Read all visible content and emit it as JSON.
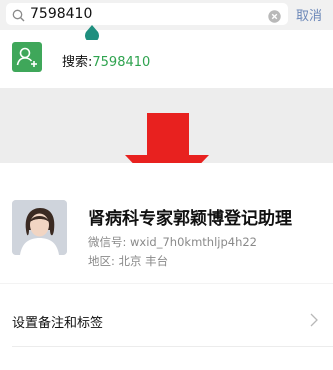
{
  "search": {
    "value": "7598410",
    "cancel_label": "取消"
  },
  "result": {
    "prefix": "搜索:",
    "keyword": "7598410"
  },
  "profile": {
    "name": "肾病科专家郭颖博登记助理",
    "wxid": "微信号: wxid_7h0kmthljp4h22",
    "region": "地区: 北京  丰台"
  },
  "remark": {
    "label": "设置备注和标签"
  },
  "colors": {
    "accent_green": "#3fa75a",
    "keyword_green": "#2fa34f",
    "arrow_red": "#e8211f",
    "cancel_blue": "#6b87b8"
  },
  "icons": [
    "search-icon",
    "clear-icon",
    "add-friend-icon",
    "down-arrow-icon",
    "chevron-right-icon"
  ]
}
